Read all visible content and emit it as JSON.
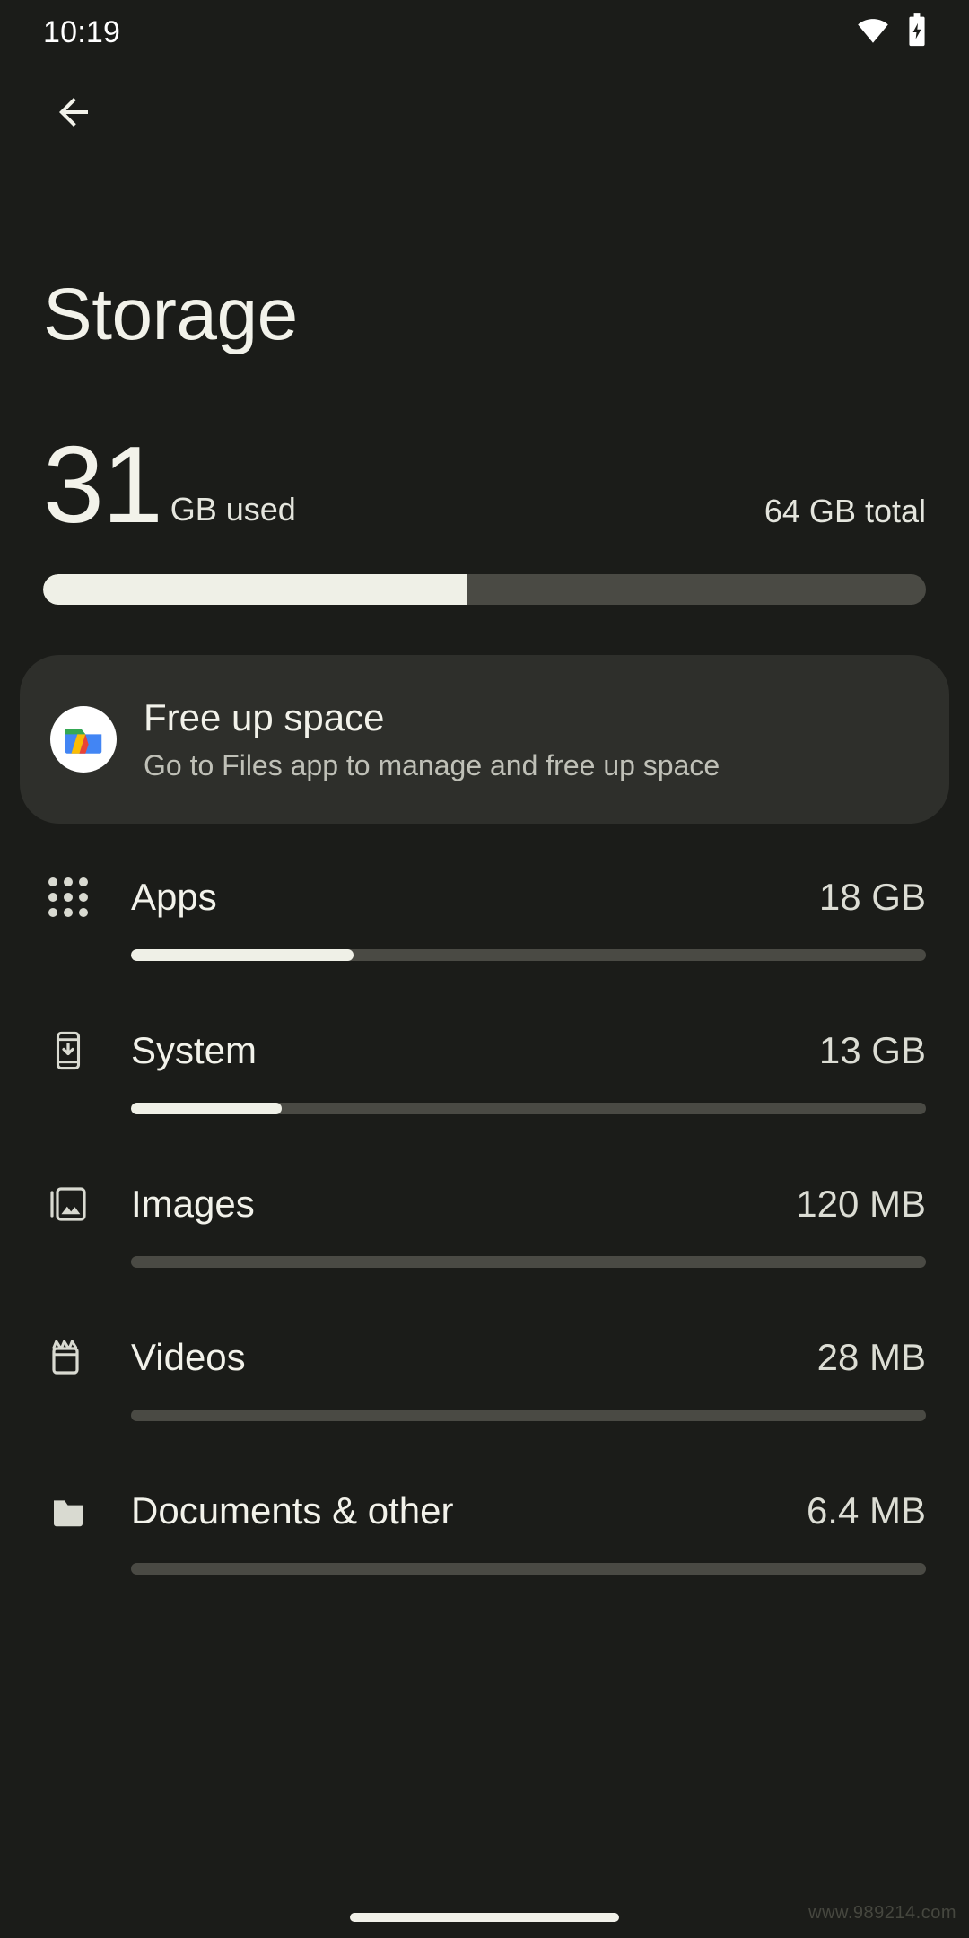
{
  "status_bar": {
    "time": "10:19",
    "icons": [
      "wifi-icon",
      "battery-charging-icon"
    ]
  },
  "appbar": {
    "back_icon": "arrow-back-icon"
  },
  "header": {
    "title": "Storage"
  },
  "summary": {
    "used_number": "31",
    "used_unit": "GB used",
    "total_label": "64 GB total",
    "fill_percent": 48,
    "fill_color": "#eff0e7",
    "track_color": "#4a4a44"
  },
  "free_up_card": {
    "icon": "files-app-icon",
    "title": "Free up space",
    "subtitle": "Go to Files app to manage and free up space"
  },
  "categories": [
    {
      "icon": "apps-grid-icon",
      "label": "Apps",
      "value": "18 GB",
      "fill_percent": 28
    },
    {
      "icon": "system-update-icon",
      "label": "System",
      "value": "13 GB",
      "fill_percent": 19
    },
    {
      "icon": "images-icon",
      "label": "Images",
      "value": "120 MB",
      "fill_percent": 0
    },
    {
      "icon": "videos-clapperboard-icon",
      "label": "Videos",
      "value": "28 MB",
      "fill_percent": 0
    },
    {
      "icon": "folder-icon",
      "label": "Documents & other",
      "value": "6.4 MB",
      "fill_percent": 0
    }
  ],
  "watermark": {
    "text": "www.989214.com"
  }
}
